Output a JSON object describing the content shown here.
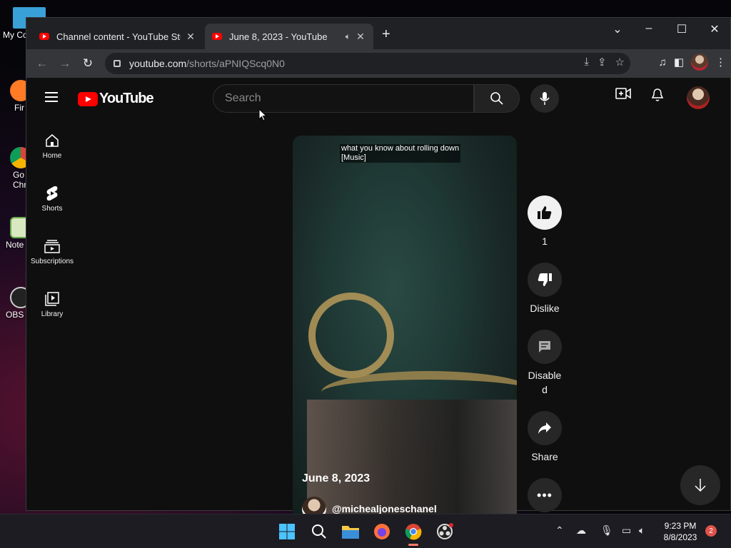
{
  "desktop": {
    "icons": [
      {
        "label": "My Co",
        "icon": "computer-icon",
        "color": "#3aa0d8"
      },
      {
        "label": "Fir",
        "icon": "firefox-icon",
        "color": "#ff7b26"
      },
      {
        "label": "Go Chr",
        "icon": "chrome-icon",
        "color": "#4285f4"
      },
      {
        "label": "Note",
        "icon": "notepad-icon",
        "color": "#6aaa4a"
      },
      {
        "label": "OBS S",
        "icon": "obs-icon",
        "color": "#222222"
      }
    ]
  },
  "browser": {
    "tabs": [
      {
        "title": "Channel content - YouTube Studio",
        "active": false
      },
      {
        "title": "June 8, 2023 - YouTube",
        "active": true
      }
    ],
    "url_host": "youtube.com",
    "url_path": "/shorts/aPNIQScq0N0"
  },
  "youtube": {
    "logo_text": "YouTube",
    "search_placeholder": "Search",
    "sidebar": [
      {
        "label": "Home",
        "icon": "home-icon"
      },
      {
        "label": "Shorts",
        "icon": "shorts-icon"
      },
      {
        "label": "Subscriptions",
        "icon": "subscriptions-icon"
      },
      {
        "label": "Library",
        "icon": "library-icon"
      }
    ],
    "short": {
      "caption_line1": "what you know about rolling down",
      "caption_line2": "[Music]",
      "title": "June 8, 2023",
      "channel": "@michealjoneschanel"
    },
    "actions": {
      "like_count": "1",
      "dislike_label": "Dislike",
      "comments_label_1": "Disable",
      "comments_label_2": "d",
      "share_label": "Share"
    }
  },
  "taskbar": {
    "time": "9:23 PM",
    "date": "8/8/2023",
    "notification_count": "2",
    "accent": "#ff7a6a"
  }
}
